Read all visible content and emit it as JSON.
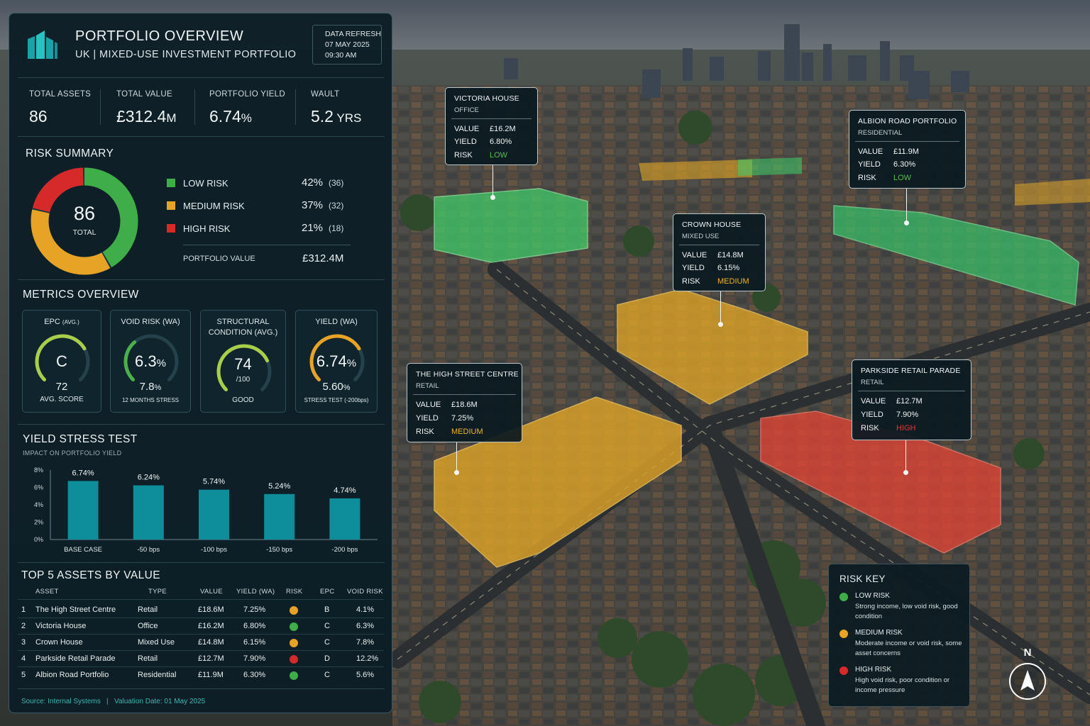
{
  "header": {
    "title": "PORTFOLIO OVERVIEW",
    "subtitle": "UK | MIXED-USE INVESTMENT PORTFOLIO",
    "refresh_label": "DATA REFRESH",
    "refresh_date": "07 MAY 2025",
    "refresh_time": "09:30 AM"
  },
  "kpis": [
    {
      "label": "TOTAL ASSETS",
      "value": "86",
      "unit": ""
    },
    {
      "label": "TOTAL VALUE",
      "value": "£312.4",
      "unit": "M"
    },
    {
      "label": "PORTFOLIO YIELD",
      "value": "6.74",
      "unit": "%"
    },
    {
      "label": "WAULT",
      "value": "5.2",
      "unit": " YRS"
    }
  ],
  "risk_summary": {
    "title": "RISK SUMMARY",
    "total": "86",
    "total_label": "TOTAL",
    "items": [
      {
        "name": "LOW RISK",
        "pct": "42%",
        "count": "(36)",
        "color": "#3fae49",
        "share": 42
      },
      {
        "name": "MEDIUM RISK",
        "pct": "37%",
        "count": "(32)",
        "color": "#e6a326",
        "share": 37
      },
      {
        "name": "HIGH RISK",
        "pct": "21%",
        "count": "(18)",
        "color": "#d62a2a",
        "share": 21
      }
    ],
    "portfolio_value_label": "PORTFOLIO VALUE",
    "portfolio_value": "£312.4M"
  },
  "metrics": {
    "title": "METRICS OVERVIEW",
    "cards": [
      {
        "title": "EPC",
        "title_small": "(AVG.)",
        "big": "C",
        "big_unit": "",
        "mid": "72",
        "mid_unit": "",
        "low": "AVG. SCORE",
        "gauge_color": "#a9cf4a",
        "fill": 0.72
      },
      {
        "title": "VOID RISK (WA)",
        "title_small": "",
        "big": "6.3",
        "big_unit": "%",
        "mid": "7.8",
        "mid_unit": "%",
        "low": "12 MONTHS STRESS",
        "gauge_color": "#4ab049",
        "fill": 0.35
      },
      {
        "title": "STRUCTURAL",
        "title2": "CONDITION (AVG.)",
        "big": "74",
        "big_sub": "/100",
        "low": "GOOD",
        "gauge_color": "#a9cf4a",
        "fill": 0.74
      },
      {
        "title": "YIELD (WA)",
        "title_small": "",
        "big": "6.74",
        "big_unit": "%",
        "mid": "5.60",
        "mid_unit": "%",
        "low": "STRESS TEST (-200bps)",
        "gauge_color": "#e6a326",
        "fill": 0.72
      }
    ]
  },
  "yield_stress": {
    "title": "YIELD STRESS TEST",
    "subtitle": "IMPACT ON PORTFOLIO YIELD"
  },
  "chart_data": {
    "type": "bar",
    "title": "YIELD STRESS TEST",
    "subtitle": "IMPACT ON PORTFOLIO YIELD",
    "categories": [
      "BASE CASE",
      "-50 bps",
      "-100 bps",
      "-150 bps",
      "-200 bps"
    ],
    "values": [
      6.74,
      6.24,
      5.74,
      5.24,
      4.74
    ],
    "data_labels": [
      "6.74%",
      "6.24%",
      "5.74%",
      "5.24%",
      "4.74%"
    ],
    "yticks": [
      "0%",
      "2%",
      "4%",
      "6%",
      "8%"
    ],
    "ylim": [
      0,
      8
    ],
    "color": "#0e8e9a",
    "grid": false
  },
  "top_assets": {
    "title": "TOP 5 ASSETS BY VALUE",
    "columns": [
      "ASSET",
      "TYPE",
      "VALUE",
      "YIELD (WA)",
      "RISK",
      "EPC",
      "VOID RISK"
    ],
    "rows": [
      {
        "rank": "1",
        "asset": "The High Street Centre",
        "type": "Retail",
        "value": "£18.6M",
        "yield": "7.25%",
        "risk_color": "#e6a326",
        "epc": "B",
        "void": "4.1%"
      },
      {
        "rank": "2",
        "asset": "Victoria House",
        "type": "Office",
        "value": "£16.2M",
        "yield": "6.80%",
        "risk_color": "#3fae49",
        "epc": "C",
        "void": "6.3%"
      },
      {
        "rank": "3",
        "asset": "Crown House",
        "type": "Mixed Use",
        "value": "£14.8M",
        "yield": "6.15%",
        "risk_color": "#e6a326",
        "epc": "C",
        "void": "7.8%"
      },
      {
        "rank": "4",
        "asset": "Parkside Retail Parade",
        "type": "Retail",
        "value": "£12.7M",
        "yield": "7.90%",
        "risk_color": "#d62a2a",
        "epc": "D",
        "void": "12.2%"
      },
      {
        "rank": "5",
        "asset": "Albion Road Portfolio",
        "type": "Residential",
        "value": "£11.9M",
        "yield": "6.30%",
        "risk_color": "#3fae49",
        "epc": "C",
        "void": "5.6%"
      }
    ],
    "footer": "Source: Internal Systems   |   Valuation Date: 01 May 2025"
  },
  "callouts": [
    {
      "name": "VICTORIA HOUSE",
      "type": "OFFICE",
      "value": "£16.2M",
      "yield": "6.80%",
      "risk": "LOW",
      "risk_color": "#4fc04f"
    },
    {
      "name": "ALBION ROAD PORTFOLIO",
      "type": "RESIDENTIAL",
      "value": "£11.9M",
      "yield": "6.30%",
      "risk": "LOW",
      "risk_color": "#4fc04f"
    },
    {
      "name": "CROWN HOUSE",
      "type": "MIXED USE",
      "value": "£14.8M",
      "yield": "6.15%",
      "risk": "MEDIUM",
      "risk_color": "#f0b42a"
    },
    {
      "name": "THE HIGH STREET CENTRE",
      "type": "RETAIL",
      "value": "£18.6M",
      "yield": "7.25%",
      "risk": "MEDIUM",
      "risk_color": "#f0b42a"
    },
    {
      "name": "PARKSIDE RETAIL PARADE",
      "type": "RETAIL",
      "value": "£12.7M",
      "yield": "7.90%",
      "risk": "HIGH",
      "risk_color": "#e8332f"
    }
  ],
  "callout_keys": {
    "value": "VALUE",
    "yield": "YIELD",
    "risk": "RISK"
  },
  "risk_key": {
    "title": "RISK KEY",
    "items": [
      {
        "name": "LOW RISK",
        "desc": "Strong income, low void risk, good condition",
        "color": "#3fae49"
      },
      {
        "name": "MEDIUM RISK",
        "desc": "Moderate income or void risk, some asset concerns",
        "color": "#e6a326"
      },
      {
        "name": "HIGH RISK",
        "desc": "High void risk, poor condition or income pressure",
        "color": "#d62a2a"
      }
    ]
  },
  "compass": {
    "label": "N",
    "icon": "north-arrow-icon"
  }
}
